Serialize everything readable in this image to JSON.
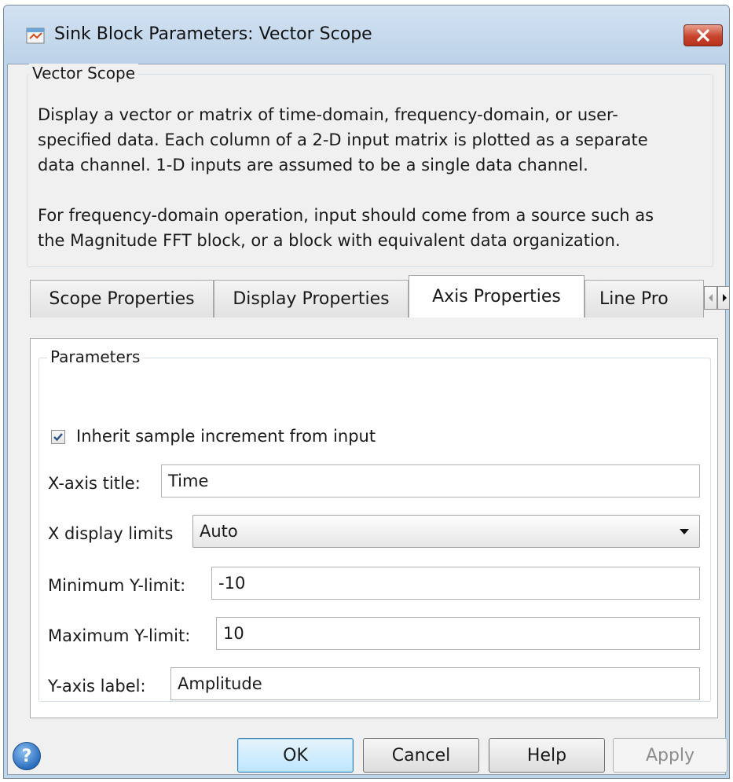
{
  "window": {
    "title": "Sink Block Parameters: Vector Scope"
  },
  "description_group": {
    "legend": "Vector Scope",
    "lines": [
      "Display a vector or matrix of time-domain, frequency-domain, or user-",
      "specified data.  Each column of a 2-D input matrix is plotted as a separate",
      "data channel.  1-D inputs are assumed to be a single data channel.",
      "",
      "For frequency-domain operation, input should come from a source such as",
      "the Magnitude FFT block, or a block with equivalent data organization."
    ]
  },
  "tabs": [
    {
      "label": "Scope Properties",
      "active": false
    },
    {
      "label": "Display Properties",
      "active": false
    },
    {
      "label": "Axis Properties",
      "active": true
    },
    {
      "label": "Line Pro",
      "active": false
    }
  ],
  "parameters": {
    "legend": "Parameters",
    "inherit_checkbox": {
      "label": "Inherit sample increment from input",
      "checked": true
    },
    "x_axis_title": {
      "label": "X-axis title:",
      "value": "Time"
    },
    "x_display_limits": {
      "label": "X display limits",
      "value": "Auto"
    },
    "min_y_limit": {
      "label": "Minimum Y-limit:",
      "value": "-10"
    },
    "max_y_limit": {
      "label": "Maximum Y-limit:",
      "value": "10"
    },
    "y_axis_label": {
      "label": "Y-axis label:",
      "value": "Amplitude"
    }
  },
  "buttons": {
    "ok": "OK",
    "cancel": "Cancel",
    "help": "Help",
    "apply": "Apply"
  },
  "icons": {
    "window": "simulink-block-icon",
    "close": "close-icon",
    "help": "help-question-icon",
    "scroll_left": "chevron-left-icon",
    "scroll_right": "chevron-right-icon",
    "dropdown": "caret-down-icon",
    "check": "checkmark-icon"
  },
  "colors": {
    "close_button": "#c8442c",
    "default_button": "#bee6fd",
    "frame": "#bfd5ea"
  }
}
